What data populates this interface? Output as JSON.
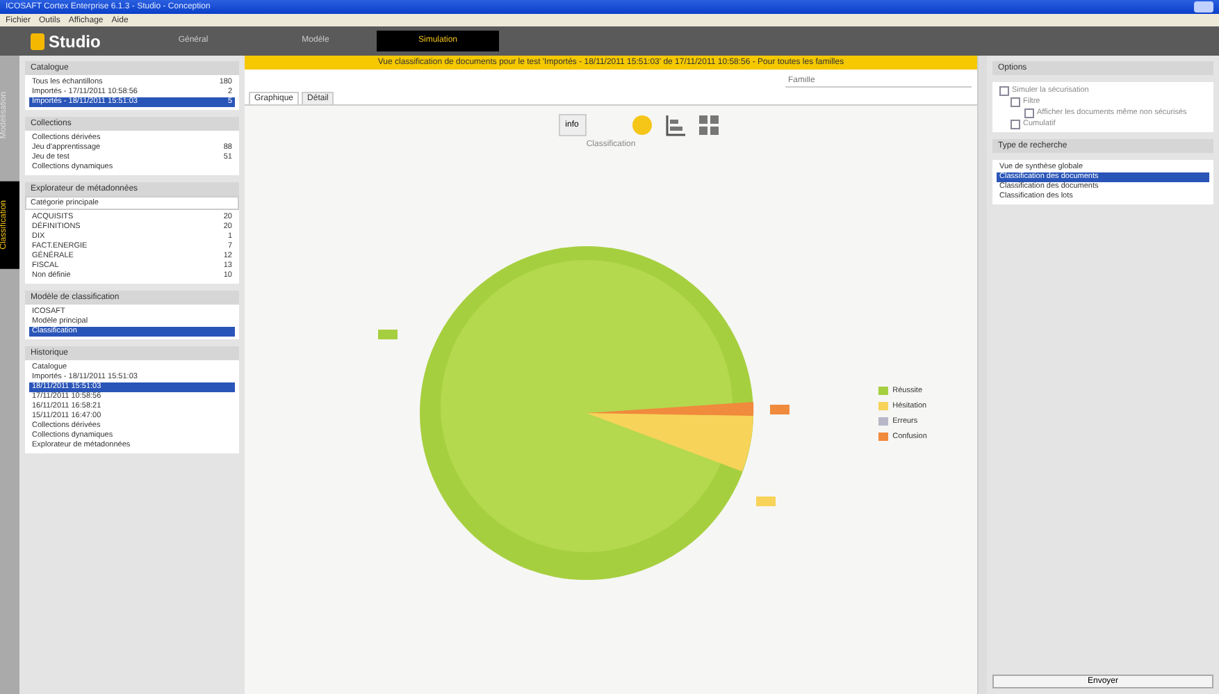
{
  "window": {
    "title": "ICOSAFT Cortex Enterprise 6.1.3 - Studio - Conception"
  },
  "menu": [
    "Fichier",
    "Outils",
    "Affichage",
    "Aide"
  ],
  "header": {
    "logo": "Studio",
    "tabs": [
      {
        "label": "Général",
        "selected": false
      },
      {
        "label": "Modèle",
        "selected": false
      },
      {
        "label": "Simulation",
        "selected": true
      }
    ]
  },
  "rail": [
    {
      "label": "Modélisation",
      "selected": false
    },
    {
      "label": "Classification",
      "selected": true
    }
  ],
  "left": {
    "sections": [
      {
        "title": "Catalogue",
        "items": [
          {
            "label": "Tous les échantillons",
            "count": "180",
            "selected": false
          },
          {
            "label": "Importés - 17/11/2011 10:58:56",
            "count": "2",
            "selected": false
          },
          {
            "label": "Importés - 18/11/2011 15:51:03",
            "count": "5",
            "selected": true
          }
        ]
      },
      {
        "title": "Collections",
        "items": [
          {
            "label": "Collections dérivées",
            "selected": false
          },
          {
            "label": "Jeu d'apprentissage",
            "count": "88",
            "selected": false
          },
          {
            "label": "Jeu de test",
            "count": "51",
            "selected": false
          },
          {
            "label": "Collections dynamiques",
            "selected": false
          }
        ]
      },
      {
        "title": "Explorateur de métadonnées",
        "dropdown": "Catégorie principale",
        "items": [
          {
            "label": "ACQUISITS",
            "count": "20",
            "selected": false
          },
          {
            "label": "DÉFINITIONS",
            "count": "20",
            "selected": false
          },
          {
            "label": "DIX",
            "count": "1",
            "selected": false
          },
          {
            "label": "FACT.ENERGIE",
            "count": "7",
            "selected": false
          },
          {
            "label": "GÉNÉRALE",
            "count": "12",
            "selected": false
          },
          {
            "label": "FISCAL",
            "count": "13",
            "selected": false
          },
          {
            "label": "Non définie",
            "count": "10",
            "selected": false
          }
        ]
      },
      {
        "title": "Modèle de classification",
        "items": [
          {
            "label": "ICOSAFT",
            "selected": false
          },
          {
            "label": "Modèle principal",
            "selected": false
          },
          {
            "label": "Classification",
            "selected": true
          }
        ]
      },
      {
        "title": "Historique",
        "items": [
          {
            "label": "Catalogue",
            "selected": false
          },
          {
            "label": "Importés - 18/11/2011 15:51:03",
            "selected": false
          },
          {
            "label": "18/11/2011 15:51:03",
            "selected": true
          },
          {
            "label": "17/11/2011 10:58:56",
            "selected": false
          },
          {
            "label": "16/11/2011 16:58:21",
            "selected": false
          },
          {
            "label": "15/11/2011 16:47:00",
            "selected": false
          },
          {
            "label": "Collections dérivées",
            "selected": false
          },
          {
            "label": "Collections dynamiques",
            "selected": false
          },
          {
            "label": "Explorateur de métadonnées",
            "selected": false
          }
        ]
      }
    ]
  },
  "center": {
    "banner": "Vue classification de documents pour le test 'Importés - 18/11/2011 15:51:03' de 17/11/2011 10:58:56 - Pour toutes les familles",
    "search": {
      "placeholder": "Famille"
    },
    "tabs": [
      {
        "label": "Graphique",
        "selected": true
      },
      {
        "label": "Détail",
        "selected": false
      }
    ],
    "info": "info",
    "chart_title": "Classification",
    "legend": [
      {
        "label": "Réussite",
        "color": "#a6cf3f"
      },
      {
        "label": "Hésitation",
        "color": "#f7d35a"
      },
      {
        "label": "Erreurs",
        "color": "#b8b8c8"
      },
      {
        "label": "Confusion",
        "color": "#f08a3c"
      }
    ]
  },
  "right": {
    "options_title": "Options",
    "options": [
      {
        "label": "Simuler la sécurisation",
        "checked": false
      },
      {
        "label": "Filtre",
        "checked": false
      },
      {
        "label": "Afficher les documents même non sécurisés",
        "checked": false
      },
      {
        "label": "Cumulatif",
        "checked": false
      }
    ],
    "search_title": "Type de recherche",
    "search_types": [
      {
        "label": "Vue de synthèse globale",
        "selected": false
      },
      {
        "label": "Classification des documents",
        "selected": true
      },
      {
        "label": "Classification des documents",
        "selected": false
      },
      {
        "label": "Classification des lots",
        "selected": false
      }
    ],
    "button": "Envoyer"
  }
}
